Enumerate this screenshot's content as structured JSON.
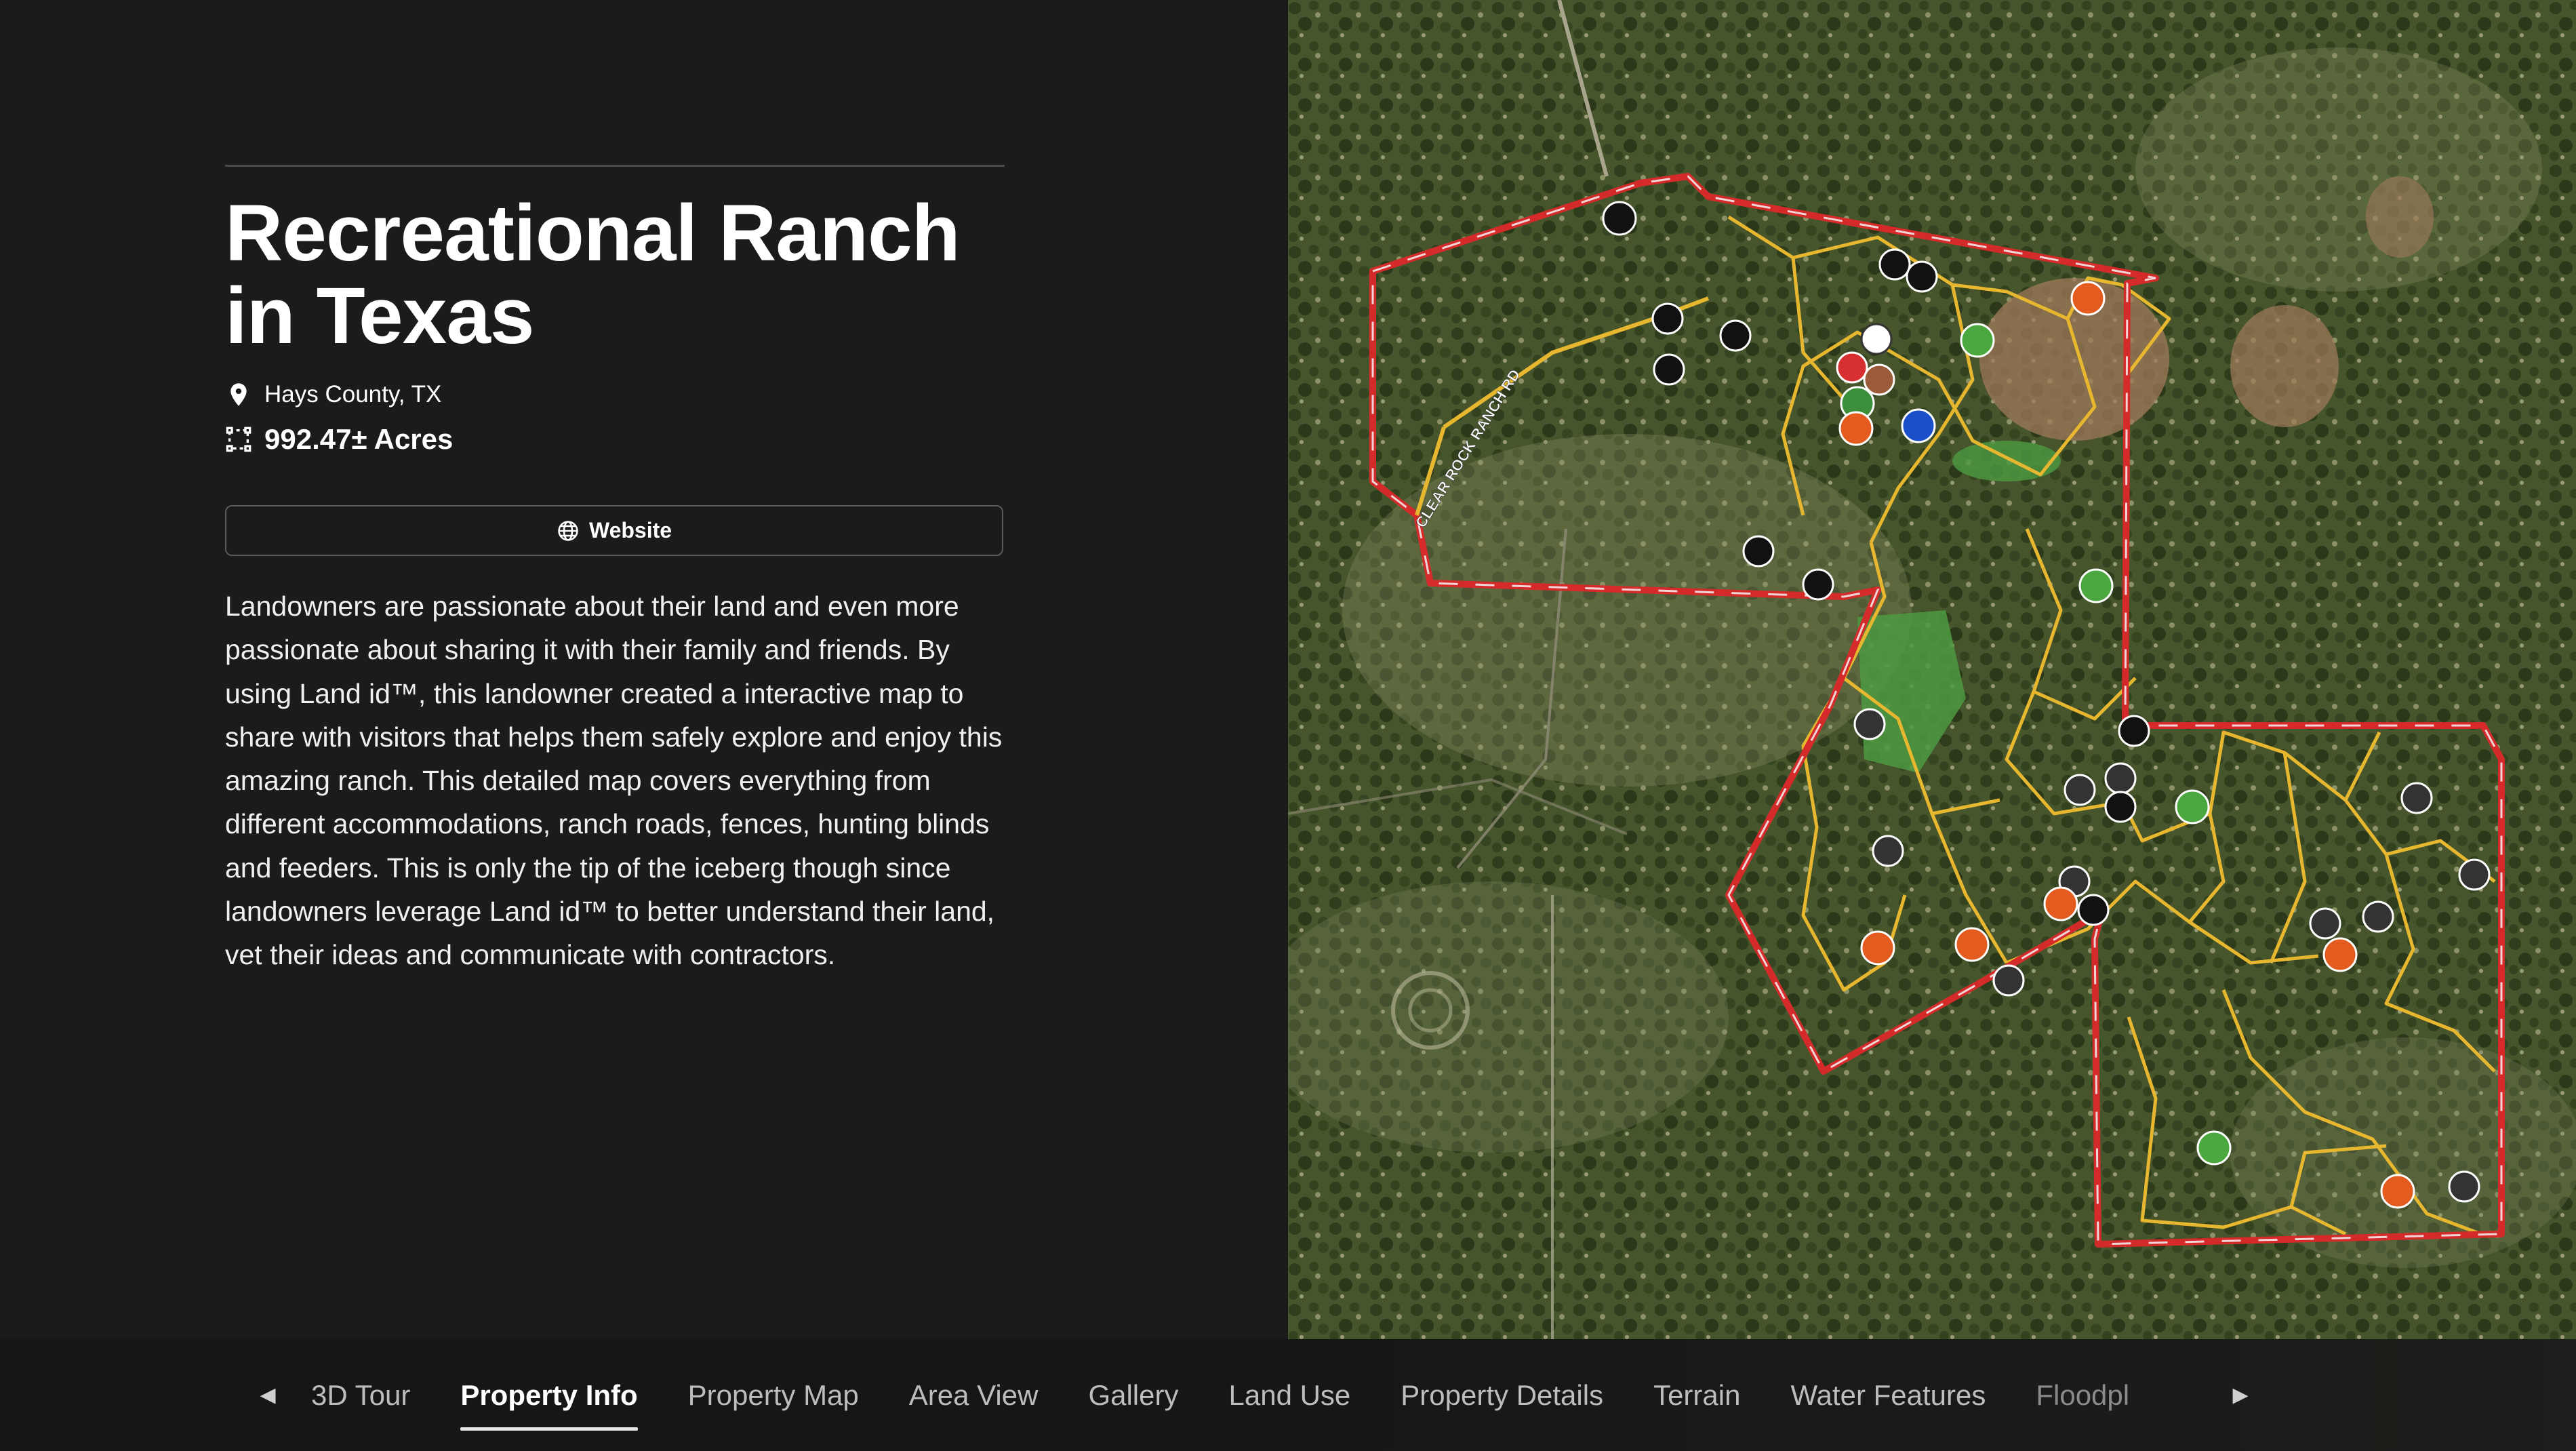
{
  "property": {
    "title": "Recreational Ranch in Texas",
    "location": "Hays County, TX",
    "acres": "992.47± Acres",
    "website_label": "Website",
    "description": "Landowners are passionate about their land and even more passionate about sharing it with their family and friends. By using Land id™, this landowner created a interactive map to share with visitors that helps them safely explore and enjoy this amazing ranch. This detailed map covers everything from different accommodations, ranch roads, fences, hunting blinds and feeders. This is only the tip of the iceberg though since landowners leverage Land id™ to better understand their land, vet their ideas and communicate with contractors."
  },
  "map": {
    "road_label": "CLEAR ROCK RANCH RD",
    "boundary_color": "#d42a2a",
    "trail_color": "#e8b730",
    "icons": "map-marker-icons"
  },
  "nav": {
    "tabs": [
      "3D Tour",
      "Property Info",
      "Property Map",
      "Area View",
      "Gallery",
      "Land Use",
      "Property Details",
      "Terrain",
      "Water Features",
      "Floodpl"
    ],
    "active": "Property Info"
  },
  "icons": {
    "location": "map-pin-icon",
    "acres": "area-select-icon",
    "website": "globe-icon"
  }
}
